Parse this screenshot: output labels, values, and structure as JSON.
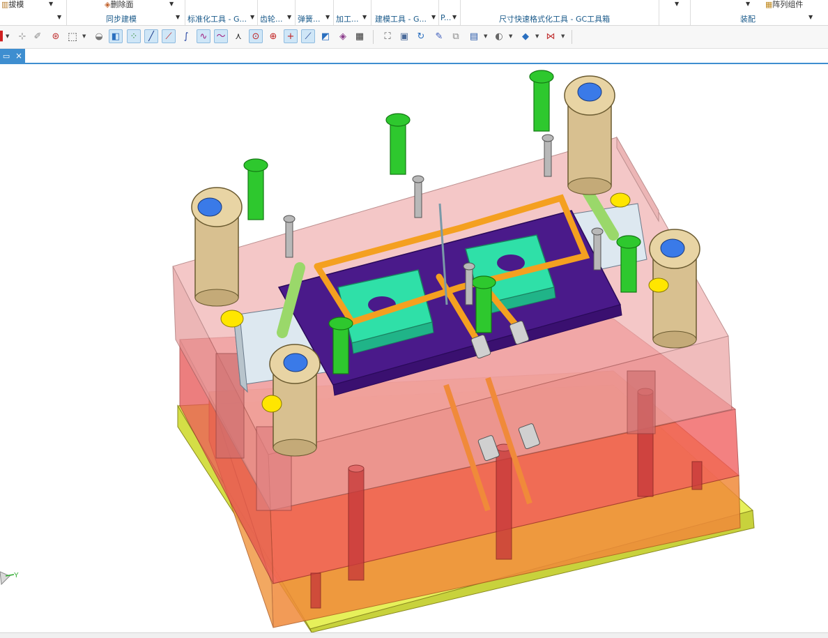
{
  "ribbon": {
    "top_cut_items": [
      {
        "label": "拔模",
        "icon": "draft-icon"
      },
      {
        "label": "删除面",
        "icon": "delete-face-icon"
      },
      {
        "label": "阵列组件",
        "icon": "pattern-component-icon"
      }
    ],
    "groups": [
      {
        "label": "同步建模"
      },
      {
        "label": "标准化工具 - G..."
      },
      {
        "label": "齿轮..."
      },
      {
        "label": "弹簧..."
      },
      {
        "label": "加工..."
      },
      {
        "label": "建模工具 - G..."
      },
      {
        "label": "P..."
      },
      {
        "label": "尺寸快速格式化工具 - GC工具箱"
      },
      {
        "label": "装配"
      }
    ]
  },
  "toolbar": {
    "icons": [
      "selection-filter-icon",
      "snap-point-icon",
      "snap-end-icon",
      "snap-mid-icon",
      "rectangle-select-icon",
      "shaded-edges-icon",
      "shaded-icon",
      "points-icon",
      "line-icon",
      "line-thru-icon",
      "curve-icon",
      "spline-icon",
      "wave-curve-icon",
      "intersection-icon",
      "center-point-icon",
      "circle-point-icon",
      "cross-point-icon",
      "tangent-line-icon",
      "face-select-icon",
      "layer-icon",
      "grid-icon",
      "fit-view-icon",
      "render-view-icon",
      "rotate-icon",
      "pan-icon",
      "zoom-icon",
      "view-orientation-icon",
      "render-style-icon",
      "solid-cube-icon",
      "clip-section-icon"
    ]
  },
  "document_tab": {
    "icon": "document-tab-icon",
    "close_icon": "close-icon",
    "close_symbol": "×"
  },
  "colors": {
    "accent": "#3e8ed0",
    "top_plate": "#e8a4a4",
    "cavity_plate": "#f06a6a",
    "clamp_plate": "#e8f060",
    "insert_green": "#2fe0a8",
    "cooling_orange": "#f4a020",
    "slider_purple": "#4a1a8a",
    "screw_green": "#2ec82e",
    "guide_bush": "#d8c090"
  },
  "triad": {
    "y_label": "Y"
  }
}
